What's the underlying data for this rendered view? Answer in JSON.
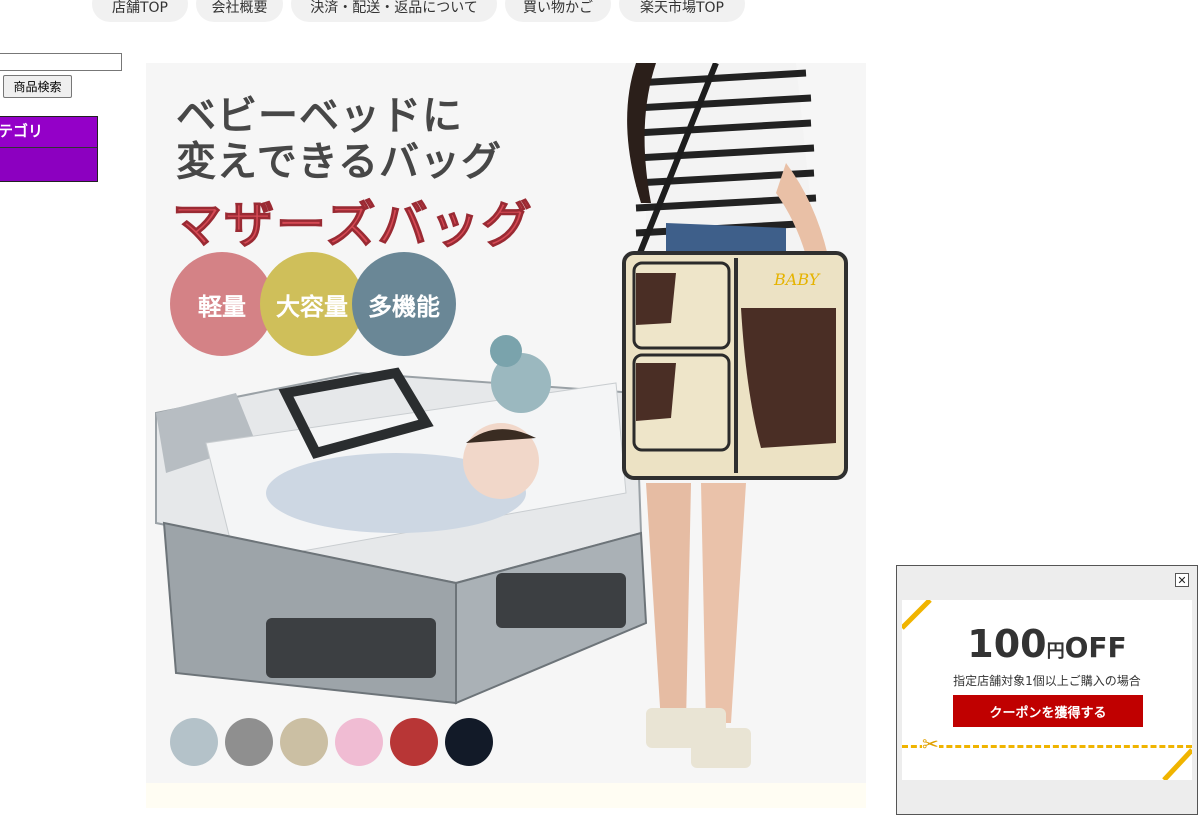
{
  "nav": {
    "items": [
      {
        "label": "店舗TOP"
      },
      {
        "label": "会社概要"
      },
      {
        "label": "決済・配送・返品について"
      },
      {
        "label": "買い物かご"
      },
      {
        "label": "楽天市場TOP"
      }
    ]
  },
  "sidebar": {
    "search_value": "",
    "search_button": "商品検索",
    "category_title": "カテゴリ"
  },
  "product": {
    "title_line1": "ベビーベッドに",
    "title_line2": "変えできるバッグ",
    "title_line3": "マザーズバッグ",
    "bag_print": "BABY",
    "features": [
      {
        "label": "軽量",
        "color": "#d48286"
      },
      {
        "label": "大容量",
        "color": "#cfbf5a"
      },
      {
        "label": "多機能",
        "color": "#6a8796"
      }
    ],
    "swatches": [
      "#b4c2c9",
      "#8f8f8f",
      "#cbbfa3",
      "#f0bcd3",
      "#b83636",
      "#121a28"
    ]
  },
  "coupon": {
    "amount": "100",
    "unit": "円",
    "off": "OFF",
    "condition": "指定店舗対象1個以上ご購入の場合",
    "button": "クーポンを獲得する",
    "accent": "#f0b400",
    "button_color": "#c00000"
  }
}
